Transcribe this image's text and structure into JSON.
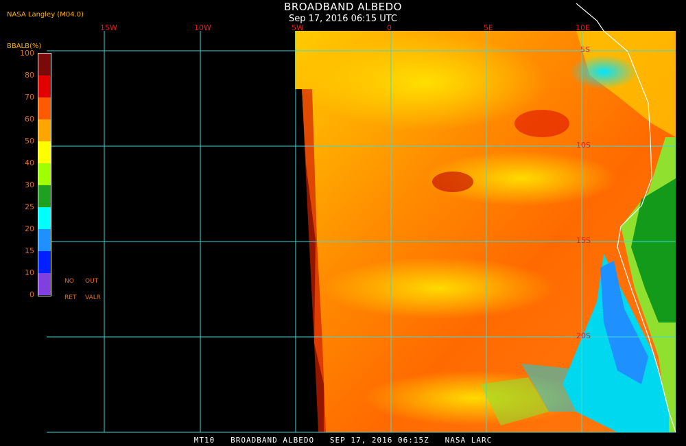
{
  "header": {
    "title": "BROADBAND ALBEDO",
    "subtitle": "Sep 17, 2016 06:15 UTC",
    "credit": "NASA Langley (M04.0)"
  },
  "longitude_labels": [
    "15W",
    "10W",
    "5W",
    "0",
    "5E",
    "10E"
  ],
  "latitude_labels": [
    "5S",
    "10S",
    "15S",
    "20S"
  ],
  "legend": {
    "title": "BBALB(%)",
    "ticks": [
      "100",
      "80",
      "70",
      "60",
      "50",
      "40",
      "30",
      "25",
      "20",
      "15",
      "10",
      "0"
    ],
    "colors": [
      "#7a0a0a",
      "#e00000",
      "#ff5a00",
      "#ffa500",
      "#ffff00",
      "#a0ff00",
      "#20a020",
      "#00ffff",
      "#1e90ff",
      "#0020ff",
      "#8040e0"
    ],
    "no_ret": [
      "NO",
      "RET"
    ],
    "out_valr": [
      "OUT",
      "VALR"
    ]
  },
  "footer": "MT10   BROADBAND ALBEDO   SEP 17, 2016 06:15Z   NASA LARC"
}
